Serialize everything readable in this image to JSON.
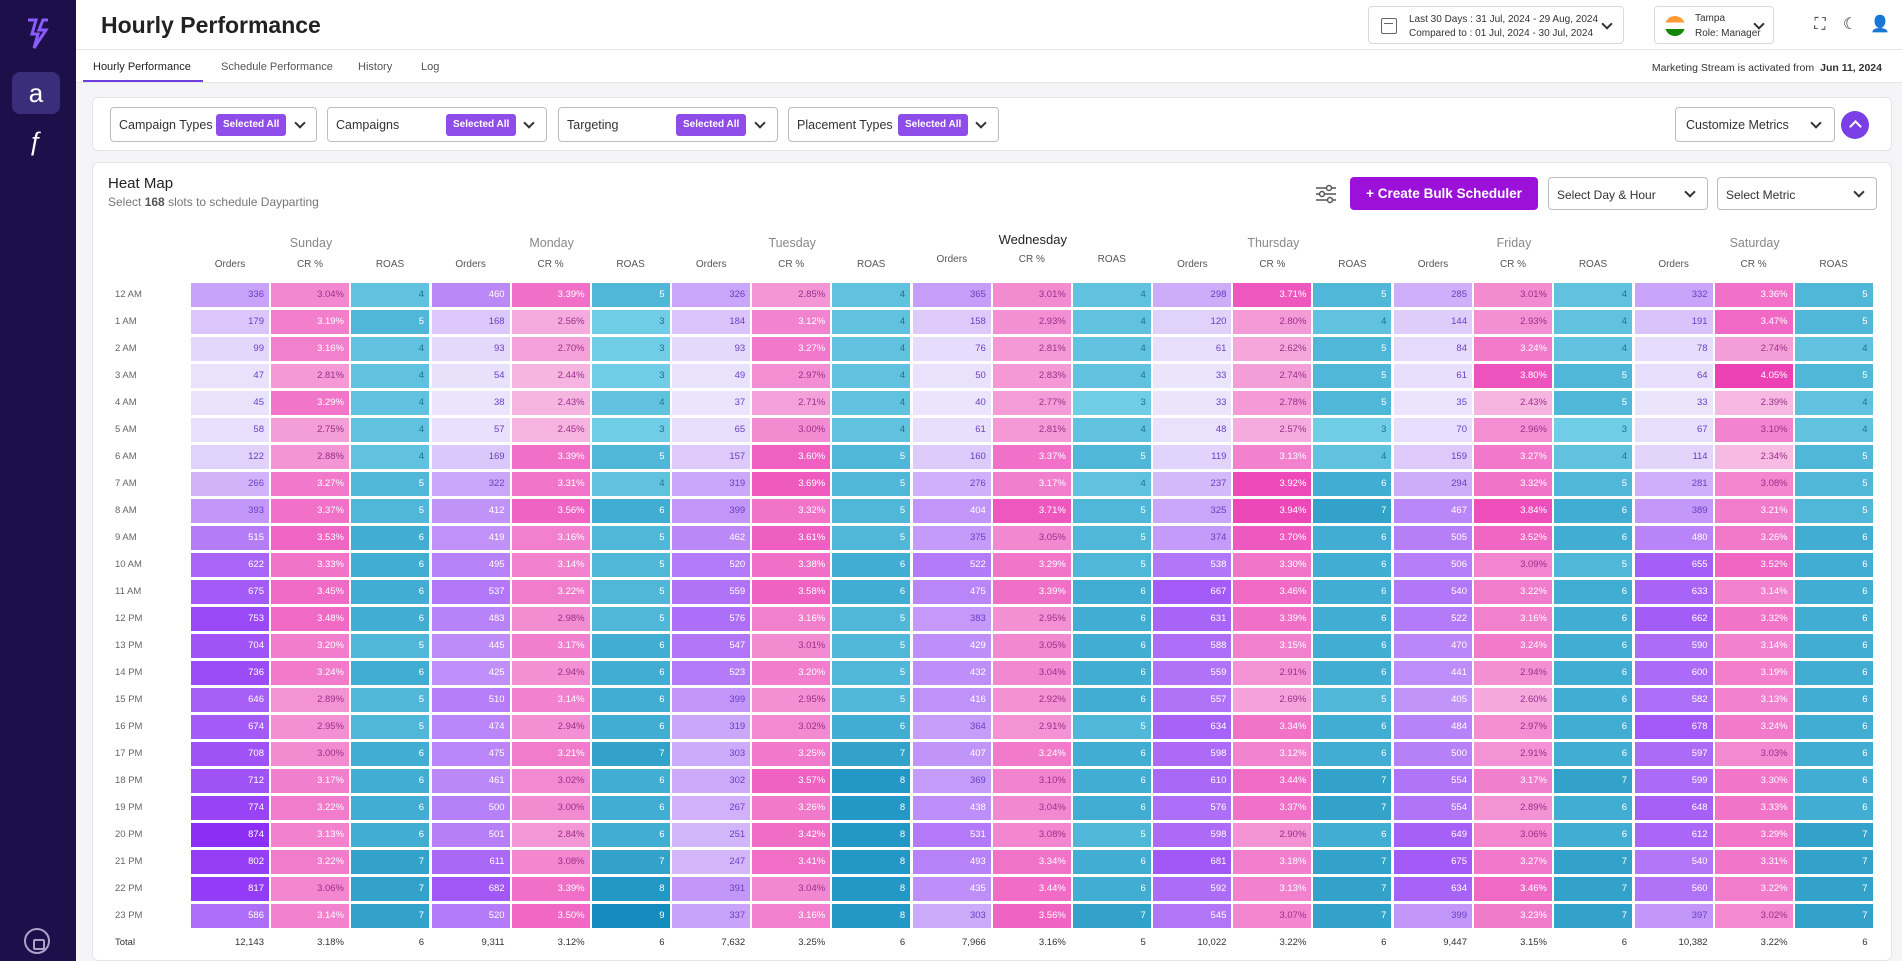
{
  "app": {
    "title": "Hourly Performance"
  },
  "header": {
    "date_line1": "Last 30 Days : 31 Jul, 2024 - 29 Aug, 2024",
    "date_line2": "Compared to : 01 Jul, 2024 - 30 Jul, 2024",
    "account": "Tampa",
    "role": "Role: Manager"
  },
  "tabs": [
    "Hourly Performance",
    "Schedule Performance",
    "History",
    "Log"
  ],
  "stream": {
    "text": "Marketing Stream is activated from",
    "date": "Jun 11, 2024"
  },
  "filters": [
    {
      "label": "Campaign Types",
      "pill": "Selected All"
    },
    {
      "label": "Campaigns",
      "pill": "Selected All"
    },
    {
      "label": "Targeting",
      "pill": "Selected All"
    },
    {
      "label": "Placement Types",
      "pill": "Selected All"
    }
  ],
  "customize": "Customize Metrics",
  "heatmap": {
    "title": "Heat Map",
    "sub_prefix": "Select",
    "slots": "168",
    "sub_suffix": "slots to schedule Dayparting",
    "bulk_button": "+ Create Bulk Scheduler",
    "select_day_hour": "Select Day & Hour",
    "select_metric": "Select Metric",
    "metric_headers": [
      "Orders",
      "CR %",
      "ROAS"
    ],
    "days": [
      "Sunday",
      "Monday",
      "Tuesday",
      "Wednesday",
      "Thursday",
      "Friday",
      "Saturday"
    ],
    "hours": [
      "12 AM",
      "1 AM",
      "2 AM",
      "3 AM",
      "4 AM",
      "5 AM",
      "6 AM",
      "7 AM",
      "8 AM",
      "9 AM",
      "10 AM",
      "11 AM",
      "12 PM",
      "13 PM",
      "14 PM",
      "15 PM",
      "16 PM",
      "17 PM",
      "18 PM",
      "19 PM",
      "20 PM",
      "21 PM",
      "22 PM",
      "23 PM"
    ],
    "total_label": "Total",
    "orders": [
      [
        336,
        460,
        326,
        365,
        298,
        285,
        332
      ],
      [
        179,
        168,
        184,
        158,
        120,
        144,
        191
      ],
      [
        99,
        93,
        93,
        76,
        61,
        84,
        78
      ],
      [
        47,
        54,
        49,
        50,
        33,
        61,
        64
      ],
      [
        45,
        38,
        37,
        40,
        33,
        35,
        33
      ],
      [
        58,
        57,
        65,
        61,
        48,
        70,
        67
      ],
      [
        122,
        169,
        157,
        160,
        119,
        159,
        114
      ],
      [
        266,
        322,
        319,
        276,
        237,
        294,
        281
      ],
      [
        393,
        412,
        399,
        404,
        325,
        467,
        389
      ],
      [
        515,
        419,
        462,
        375,
        374,
        505,
        480
      ],
      [
        622,
        495,
        520,
        522,
        538,
        506,
        655
      ],
      [
        675,
        537,
        559,
        475,
        667,
        540,
        633
      ],
      [
        753,
        483,
        576,
        383,
        631,
        522,
        662
      ],
      [
        704,
        445,
        547,
        429,
        588,
        470,
        590
      ],
      [
        736,
        425,
        523,
        432,
        559,
        441,
        600
      ],
      [
        646,
        510,
        399,
        416,
        557,
        405,
        582
      ],
      [
        674,
        474,
        319,
        364,
        634,
        484,
        678
      ],
      [
        708,
        475,
        303,
        407,
        598,
        500,
        597
      ],
      [
        712,
        461,
        302,
        369,
        610,
        554,
        599
      ],
      [
        774,
        500,
        267,
        438,
        576,
        554,
        648
      ],
      [
        874,
        501,
        251,
        531,
        598,
        649,
        612
      ],
      [
        802,
        611,
        247,
        493,
        681,
        675,
        540
      ],
      [
        817,
        682,
        391,
        435,
        592,
        634,
        560
      ],
      [
        586,
        520,
        337,
        303,
        545,
        399,
        397
      ]
    ],
    "cr": [
      [
        "3.04%",
        "3.39%",
        "2.85%",
        "3.01%",
        "3.71%",
        "3.01%",
        "3.36%"
      ],
      [
        "3.19%",
        "2.56%",
        "3.12%",
        "2.93%",
        "2.80%",
        "2.93%",
        "3.47%"
      ],
      [
        "3.16%",
        "2.70%",
        "3.27%",
        "2.81%",
        "2.62%",
        "3.24%",
        "2.74%"
      ],
      [
        "2.81%",
        "2.44%",
        "2.97%",
        "2.83%",
        "2.74%",
        "3.80%",
        "4.05%"
      ],
      [
        "3.29%",
        "2.43%",
        "2.71%",
        "2.77%",
        "2.78%",
        "2.43%",
        "2.39%"
      ],
      [
        "2.75%",
        "2.45%",
        "3.00%",
        "2.81%",
        "2.57%",
        "2.96%",
        "3.10%"
      ],
      [
        "2.88%",
        "3.39%",
        "3.60%",
        "3.37%",
        "3.13%",
        "3.27%",
        "2.34%"
      ],
      [
        "3.27%",
        "3.31%",
        "3.69%",
        "3.17%",
        "3.92%",
        "3.32%",
        "3.08%"
      ],
      [
        "3.37%",
        "3.56%",
        "3.32%",
        "3.71%",
        "3.94%",
        "3.84%",
        "3.21%"
      ],
      [
        "3.53%",
        "3.16%",
        "3.61%",
        "3.05%",
        "3.70%",
        "3.52%",
        "3.26%"
      ],
      [
        "3.33%",
        "3.14%",
        "3.38%",
        "3.29%",
        "3.30%",
        "3.09%",
        "3.52%"
      ],
      [
        "3.45%",
        "3.22%",
        "3.58%",
        "3.39%",
        "3.46%",
        "3.22%",
        "3.14%"
      ],
      [
        "3.48%",
        "2.98%",
        "3.16%",
        "2.95%",
        "3.39%",
        "3.16%",
        "3.32%"
      ],
      [
        "3.20%",
        "3.17%",
        "3.01%",
        "3.05%",
        "3.15%",
        "3.24%",
        "3.14%"
      ],
      [
        "3.24%",
        "2.94%",
        "3.20%",
        "3.04%",
        "2.91%",
        "2.94%",
        "3.19%"
      ],
      [
        "2.89%",
        "3.14%",
        "2.95%",
        "2.92%",
        "2.69%",
        "2.60%",
        "3.13%"
      ],
      [
        "2.95%",
        "2.94%",
        "3.02%",
        "2.91%",
        "3.34%",
        "2.97%",
        "3.24%"
      ],
      [
        "3.00%",
        "3.21%",
        "3.25%",
        "3.24%",
        "3.12%",
        "2.91%",
        "3.03%"
      ],
      [
        "3.17%",
        "3.02%",
        "3.57%",
        "3.10%",
        "3.44%",
        "3.17%",
        "3.30%"
      ],
      [
        "3.22%",
        "3.00%",
        "3.26%",
        "3.04%",
        "3.37%",
        "2.89%",
        "3.33%"
      ],
      [
        "3.13%",
        "2.84%",
        "3.42%",
        "3.08%",
        "2.90%",
        "3.06%",
        "3.29%"
      ],
      [
        "3.22%",
        "3.08%",
        "3.41%",
        "3.34%",
        "3.18%",
        "3.27%",
        "3.31%"
      ],
      [
        "3.06%",
        "3.39%",
        "3.04%",
        "3.44%",
        "3.13%",
        "3.46%",
        "3.22%"
      ],
      [
        "3.14%",
        "3.50%",
        "3.16%",
        "3.56%",
        "3.07%",
        "3.23%",
        "3.02%"
      ]
    ],
    "roas": [
      [
        4,
        5,
        4,
        4,
        5,
        4,
        5
      ],
      [
        5,
        3,
        4,
        4,
        4,
        4,
        5
      ],
      [
        4,
        3,
        4,
        4,
        5,
        4,
        4
      ],
      [
        4,
        3,
        4,
        4,
        5,
        5,
        5
      ],
      [
        4,
        4,
        4,
        3,
        5,
        5,
        4
      ],
      [
        4,
        3,
        4,
        4,
        3,
        3,
        4
      ],
      [
        4,
        5,
        5,
        5,
        4,
        4,
        5
      ],
      [
        5,
        4,
        5,
        4,
        6,
        5,
        5
      ],
      [
        5,
        6,
        5,
        5,
        7,
        6,
        5
      ],
      [
        6,
        5,
        5,
        5,
        6,
        6,
        6
      ],
      [
        6,
        5,
        6,
        5,
        6,
        5,
        6
      ],
      [
        6,
        5,
        6,
        6,
        6,
        6,
        6
      ],
      [
        6,
        5,
        5,
        6,
        6,
        6,
        6
      ],
      [
        5,
        6,
        5,
        6,
        6,
        6,
        6
      ],
      [
        6,
        6,
        5,
        6,
        6,
        6,
        6
      ],
      [
        5,
        6,
        5,
        6,
        5,
        6,
        6
      ],
      [
        5,
        6,
        6,
        5,
        6,
        6,
        6
      ],
      [
        6,
        7,
        7,
        6,
        6,
        6,
        6
      ],
      [
        6,
        6,
        8,
        6,
        7,
        7,
        6
      ],
      [
        6,
        6,
        8,
        6,
        7,
        6,
        6
      ],
      [
        6,
        6,
        8,
        5,
        6,
        6,
        7
      ],
      [
        7,
        7,
        8,
        6,
        7,
        7,
        7
      ],
      [
        7,
        8,
        8,
        6,
        7,
        7,
        7
      ],
      [
        7,
        9,
        8,
        7,
        7,
        7,
        7
      ]
    ],
    "totals": [
      [
        "12,143",
        "3.18%",
        "6"
      ],
      [
        "9,311",
        "3.12%",
        "6"
      ],
      [
        "7,632",
        "3.25%",
        "6"
      ],
      [
        "7,966",
        "3.16%",
        "5"
      ],
      [
        "10,022",
        "3.22%",
        "6"
      ],
      [
        "9,447",
        "3.15%",
        "6"
      ],
      [
        "10,382",
        "3.22%",
        "6"
      ]
    ]
  },
  "colors": {
    "accent": "#8e4ce9",
    "sidebar": "#1c0f4a",
    "bulk": "#9b11d9"
  }
}
